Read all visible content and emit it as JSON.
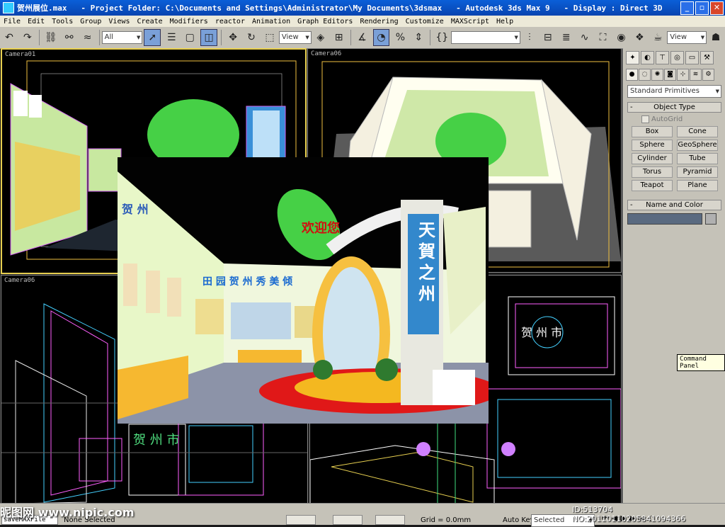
{
  "window": {
    "title": "贺州展位.max   - Project Folder: C:\\Documents and Settings\\Administrator\\My Documents\\3dsmax   - Autodesk 3ds Max 9   - Display : Direct 3D",
    "minimize": "_",
    "maximize": "▫",
    "close": "✕"
  },
  "menu": [
    "File",
    "Edit",
    "Tools",
    "Group",
    "Views",
    "Create",
    "Modifiers",
    "reactor",
    "Animation",
    "Graph Editors",
    "Rendering",
    "Customize",
    "MAXScript",
    "Help"
  ],
  "toolbar": {
    "selection_filter": "All",
    "ref_coord": "View",
    "named_sel": "",
    "view_right": "View"
  },
  "viewports": {
    "top_left": "Camera01",
    "top_right": "Camera06",
    "bottom_left": "Camera06"
  },
  "render_texts": {
    "sign_vertical": "天賀之州",
    "welcome": "欢迎您",
    "banner_left": "贺 州",
    "banner_row": "田 园 贺 州  秀 美 倾",
    "wire_top": "贺 州 市",
    "wire_bottom_left": "贺 州 市"
  },
  "command_panel": {
    "category_dropdown": "Standard Primitives",
    "object_type_header": "Object Type",
    "autogrid_label": "AutoGrid",
    "buttons": [
      "Box",
      "Cone",
      "Sphere",
      "GeoSphere",
      "Cylinder",
      "Tube",
      "Torus",
      "Pyramid",
      "Teapot",
      "Plane"
    ],
    "name_color_header": "Name and Color",
    "name_value": ""
  },
  "tooltip": "Command Panel",
  "status": {
    "maxscript": "saveMAXFile \"",
    "selection": "None Selected",
    "grid": "Grid = 0.0mm",
    "autokey": "Auto Key",
    "selected": "Selected"
  },
  "watermark": {
    "site": "昵图网 www.nipic.com",
    "id": "ID:513704 NO:20110110205841094366"
  }
}
